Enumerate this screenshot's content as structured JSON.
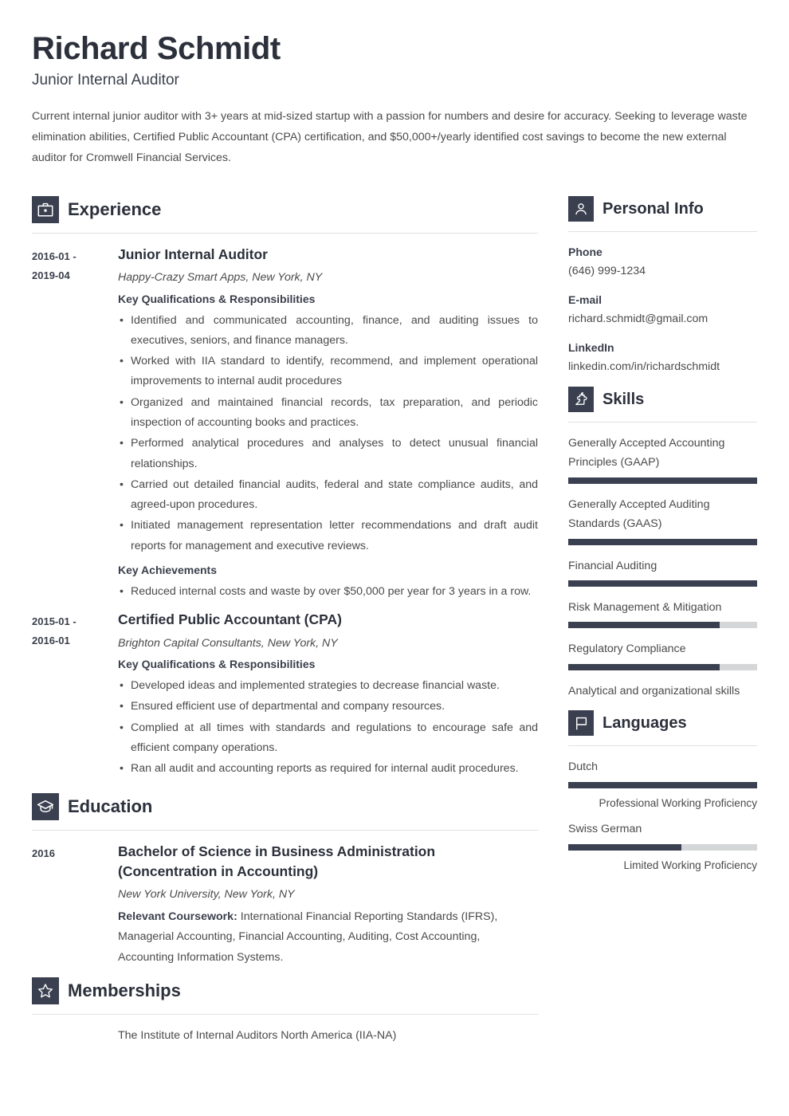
{
  "header": {
    "name": "Richard Schmidt",
    "job_title": "Junior Internal Auditor",
    "summary": "Current internal junior auditor with 3+ years at mid-sized startup with a passion for numbers and desire for accuracy. Seeking to leverage waste elimination abilities, Certified Public Accountant (CPA) certification, and $50,000+/yearly identified cost savings to become the new external auditor for Cromwell Financial Services."
  },
  "sections": {
    "experience": {
      "title": "Experience",
      "icon": "briefcase-icon"
    },
    "education": {
      "title": "Education",
      "icon": "graduation-cap-icon"
    },
    "memberships": {
      "title": "Memberships",
      "icon": "star-icon"
    },
    "personal_info": {
      "title": "Personal Info",
      "icon": "person-icon"
    },
    "skills": {
      "title": "Skills",
      "icon": "puzzle-piece-icon"
    },
    "languages": {
      "title": "Languages",
      "icon": "flag-icon"
    }
  },
  "experience": [
    {
      "date_start": "2016-01 -",
      "date_end": "2019-04",
      "title": "Junior Internal Auditor",
      "org": "Happy-Crazy Smart Apps, New York, NY",
      "qualifications_label": "Key Qualifications & Responsibilities",
      "qualifications": [
        "Identified and communicated accounting, finance, and auditing issues to executives, seniors, and finance managers.",
        "Worked with IIA standard to identify, recommend, and implement operational improvements to internal audit procedures",
        "Organized and maintained financial records, tax preparation, and periodic inspection of accounting books and practices.",
        "Performed analytical procedures and analyses to detect unusual financial relationships.",
        "Carried out detailed financial audits, federal and state compliance audits, and agreed-upon procedures.",
        "Initiated management representation letter recommendations and draft audit reports for management and executive reviews."
      ],
      "achievements_label": "Key Achievements",
      "achievements": [
        "Reduced internal costs and waste by over $50,000 per year for 3 years in a row."
      ]
    },
    {
      "date_start": "2015-01 -",
      "date_end": "2016-01",
      "title": "Certified Public Accountant (CPA)",
      "org": "Brighton Capital Consultants, New York, NY",
      "qualifications_label": "Key Qualifications & Responsibilities",
      "qualifications": [
        "Developed ideas and implemented strategies to decrease financial waste.",
        "Ensured efficient use of departmental and company resources.",
        "Complied at all times with standards and regulations to encourage safe and efficient company operations.",
        "Ran all audit and accounting reports as required for internal audit procedures."
      ]
    }
  ],
  "education": [
    {
      "date": "2016",
      "degree": "Bachelor of Science in Business Administration (Concentration in Accounting)",
      "school": "New York University, New York, NY",
      "coursework_label": "Relevant Coursework:",
      "coursework": " International Financial Reporting Standards (IFRS), Managerial Accounting, Financial Accounting, Auditing, Cost Accounting, Accounting Information Systems."
    }
  ],
  "memberships": [
    "The Institute of Internal Auditors North America (IIA-NA)"
  ],
  "personal_info": [
    {
      "label": "Phone",
      "value": "(646) 999-1234"
    },
    {
      "label": "E-mail",
      "value": "richard.schmidt@gmail.com"
    },
    {
      "label": "LinkedIn",
      "value": "linkedin.com/in/richardschmidt"
    }
  ],
  "skills": [
    {
      "name": "Generally Accepted Accounting Principles (GAAP)",
      "level": 100,
      "has_bar": true
    },
    {
      "name": "Generally Accepted Auditing Standards (GAAS)",
      "level": 100,
      "has_bar": true
    },
    {
      "name": "Financial Auditing",
      "level": 100,
      "has_bar": true
    },
    {
      "name": "Risk Management & Mitigation",
      "level": 80,
      "has_bar": true
    },
    {
      "name": "Regulatory Compliance",
      "level": 80,
      "has_bar": true
    },
    {
      "name": "Analytical and organizational skills",
      "level": 0,
      "has_bar": false
    }
  ],
  "languages": [
    {
      "name": "Dutch",
      "level": 100,
      "proficiency": "Professional Working Proficiency"
    },
    {
      "name": "Swiss German",
      "level": 60,
      "proficiency": "Limited Working Proficiency"
    }
  ],
  "colors": {
    "accent_dark": "#3b4050",
    "heading": "#2b303b",
    "body_text": "#4a4a4a",
    "bar_track": "#d4d6d7",
    "rule": "#e1e1e1"
  }
}
